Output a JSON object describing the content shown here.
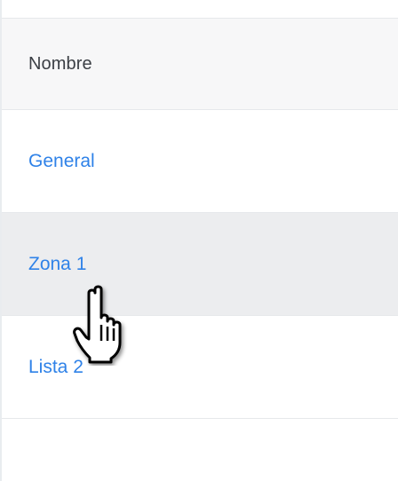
{
  "table": {
    "columns": [
      "Nombre"
    ],
    "rows": [
      {
        "name": "General"
      },
      {
        "name": "Zona 1"
      },
      {
        "name": "Lista 2"
      }
    ],
    "hovered_row": "Zona 1"
  },
  "colors": {
    "link": "#2f82e8",
    "header_bg": "#f7f7f8",
    "hover_bg": "#ecedef",
    "border": "#e6e8eb"
  },
  "cursor": {
    "icon": "hand-pointer-icon"
  }
}
